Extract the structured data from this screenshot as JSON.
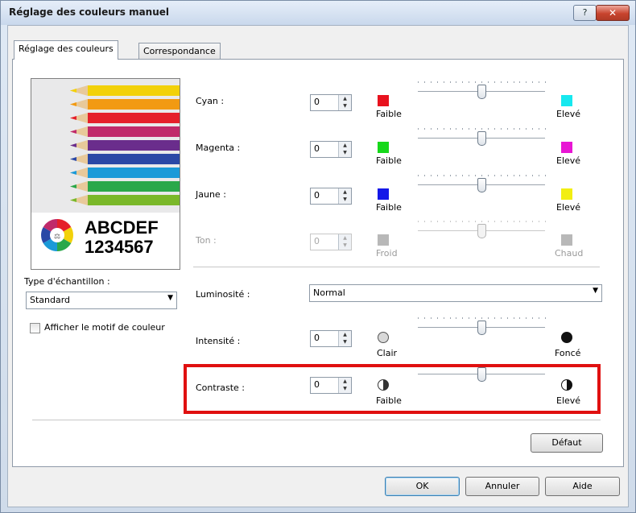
{
  "window": {
    "title": "Réglage des couleurs manuel",
    "help_glyph": "?",
    "close_glyph": "✕"
  },
  "tabs": [
    {
      "label": "Réglage des couleurs",
      "active": true
    },
    {
      "label": "Correspondance",
      "active": false
    }
  ],
  "preview": {
    "text_line1": "ABCDEF",
    "text_line2": "1234567",
    "icon": "color-wheel-icon",
    "pencil_colors": [
      "#f2d10a",
      "#f29a12",
      "#e5202a",
      "#c02a6a",
      "#6a2d8c",
      "#2a48a6",
      "#1a9ad8",
      "#2aa84a",
      "#7ab82a"
    ]
  },
  "sample_type": {
    "label": "Type d'échantillon :",
    "selected": "Standard"
  },
  "show_pattern": {
    "label": "Afficher le motif de couleur",
    "checked": false
  },
  "rows": [
    {
      "label": "Cyan :",
      "value": "0",
      "low_label": "Faible",
      "high_label": "Elevé",
      "low_color": "#e8121e",
      "high_color": "#17e8ef",
      "enabled": true
    },
    {
      "label": "Magenta :",
      "value": "0",
      "low_label": "Faible",
      "high_label": "Elevé",
      "low_color": "#16d81a",
      "high_color": "#e816d4",
      "enabled": true
    },
    {
      "label": "Jaune :",
      "value": "0",
      "low_label": "Faible",
      "high_label": "Elevé",
      "low_color": "#1418e8",
      "high_color": "#f2ee12",
      "enabled": true
    },
    {
      "label": "Ton :",
      "value": "0",
      "low_label": "Froid",
      "high_label": "Chaud",
      "low_color": "#b8b8b8",
      "high_color": "#b8b8b8",
      "enabled": false
    }
  ],
  "luminosity": {
    "label": "Luminosité :",
    "selected": "Normal"
  },
  "intensity": {
    "label": "Intensité :",
    "value": "0",
    "low_label": "Clair",
    "high_label": "Foncé"
  },
  "contrast": {
    "label": "Contraste :",
    "value": "0",
    "low_label": "Faible",
    "high_label": "Elevé"
  },
  "slider_level": 0.5,
  "buttons": {
    "default": "Défaut",
    "ok": "OK",
    "cancel": "Annuler",
    "help": "Aide"
  },
  "highlight_color": "#e01010"
}
